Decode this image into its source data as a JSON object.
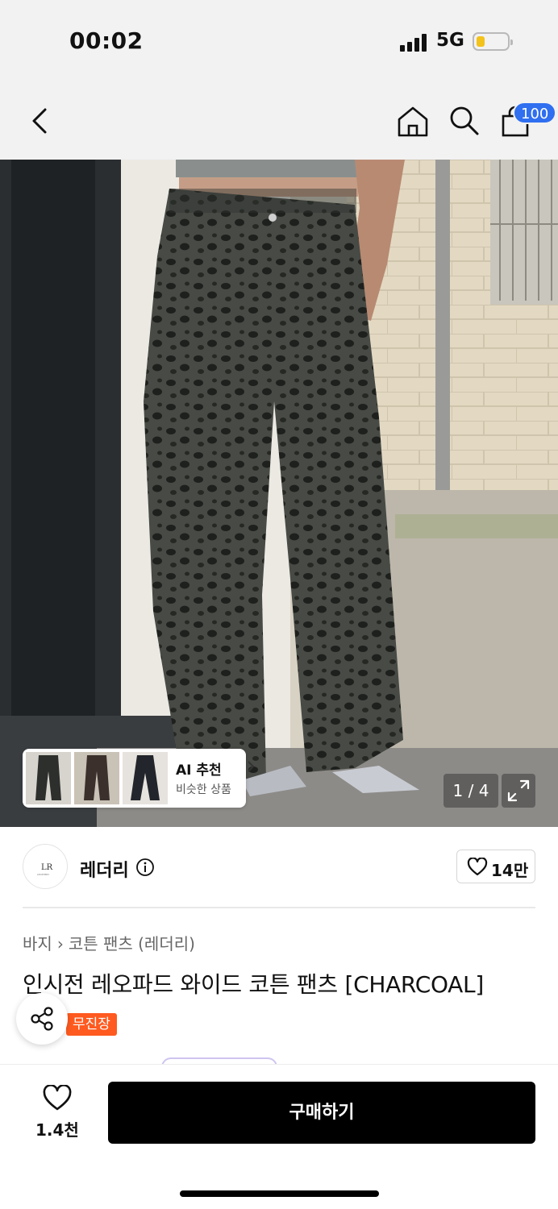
{
  "status_bar": {
    "time": "00:02",
    "network": "5G",
    "battery_color": "#f3c21b"
  },
  "nav": {
    "back_icon": "chevron-left-icon",
    "home_icon": "home-icon",
    "search_icon": "search-icon",
    "cart_icon": "shopping-bag-icon",
    "cart_badge": "100",
    "badge_color": "#2f6ff0"
  },
  "gallery": {
    "page_indicator": "1 / 4",
    "ai_card": {
      "title": "AI 추천",
      "subtitle": "비슷한 상품"
    }
  },
  "brand": {
    "name": "레더리",
    "logo_text": "LR",
    "like_count": "14만"
  },
  "breadcrumb": {
    "level1": "바지",
    "level2": "코튼 팬츠 (레더리)"
  },
  "product": {
    "title": "인시전 레오파드 와이드 코튼 팬츠 [CHARCOAL]",
    "tag": "무진장",
    "tag_color": "#ff5a1f"
  },
  "bottom": {
    "wish_count": "1.4천",
    "buy_label": "구매하기"
  }
}
